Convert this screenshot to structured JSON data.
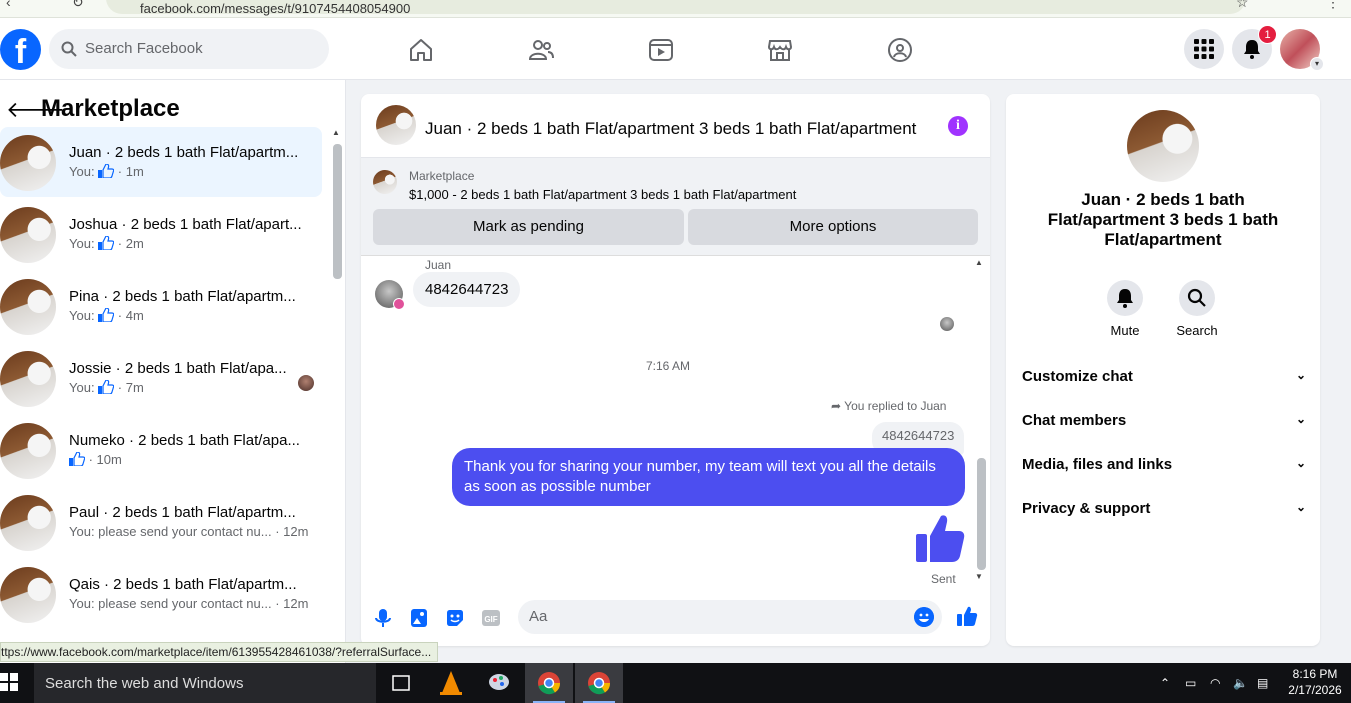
{
  "browser": {
    "url": "facebook.com/messages/t/9107454408054900"
  },
  "nav": {
    "search_placeholder": "Search Facebook",
    "notif_count": "1"
  },
  "sidebar": {
    "title": "Marketplace",
    "threads": [
      {
        "name": "Juan · 2 beds 1 bath Flat/apartm...",
        "sub": "You: ",
        "time": " · 1m",
        "thumb": true
      },
      {
        "name": "Joshua · 2 beds 1 bath Flat/apart...",
        "sub": "You: ",
        "time": " · 2m",
        "thumb": true
      },
      {
        "name": "Pina · 2 beds 1 bath Flat/apartm...",
        "sub": "You: ",
        "time": " · 4m",
        "thumb": true
      },
      {
        "name": "Jossie · 2 beds 1 bath Flat/apa...",
        "sub": "You: ",
        "time": " · 7m",
        "thumb": true
      },
      {
        "name": "Numeko · 2 beds 1 bath Flat/apa...",
        "sub": "",
        "time": " · 10m",
        "thumb": true
      },
      {
        "name": "Paul · 2 beds 1 bath Flat/apartm...",
        "sub": "You: please send your contact nu...",
        "time": " · 12m"
      },
      {
        "name": "Qais · 2 beds 1 bath Flat/apartm...",
        "sub": "You: please send your contact nu...",
        "time": " · 12m"
      }
    ]
  },
  "chat": {
    "title": "Juan · 2 beds 1 bath Flat/apartment 3 beds 1 bath Flat/apartment",
    "marketplace_label": "Marketplace",
    "listing": "$1,000 - 2 beds 1 bath Flat/apartment 3 beds 1 bath Flat/apartment",
    "btn_pending": "Mark as pending",
    "btn_more": "More options",
    "sender": "Juan",
    "incoming": "4842644723",
    "time": "7:16 AM",
    "replied": "You replied to Juan",
    "quote": "4842644723",
    "outgoing": "Thank you for  sharing your number, my team will text you all the details as soon as possible number",
    "sent": "Sent",
    "input_placeholder": "Aa"
  },
  "details": {
    "name": "Juan · 2 beds 1 bath Flat/apartment 3 beds 1 bath Flat/apartment",
    "mute": "Mute",
    "search": "Search",
    "rows": [
      "Customize chat",
      "Chat members",
      "Media, files and links",
      "Privacy & support"
    ]
  },
  "statusbar": "ttps://www.facebook.com/marketplace/item/613955428461038/?referralSurface...",
  "taskbar": {
    "search": "Search the web and Windows",
    "time": "8:16 PM",
    "date": "2/17/2026"
  },
  "colors": {
    "accent": "#0866ff",
    "outgoing_bubble": "#4c4ef0",
    "info": "#a033ff"
  }
}
